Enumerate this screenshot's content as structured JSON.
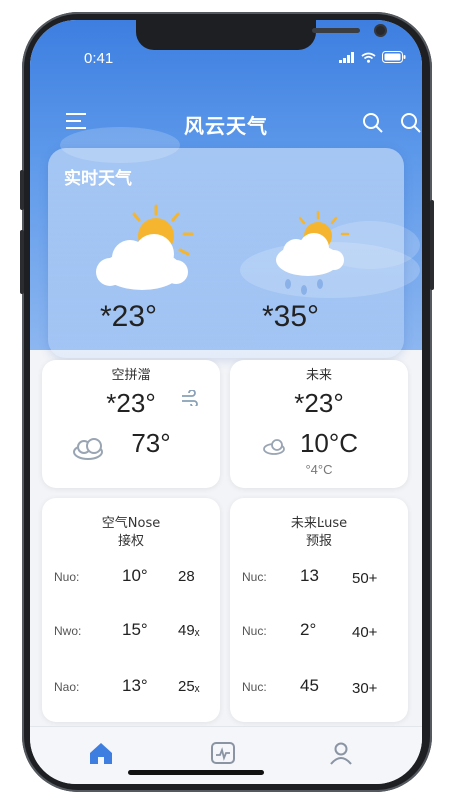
{
  "status": {
    "time": "0:41"
  },
  "header": {
    "title": "风云天气"
  },
  "hero": {
    "title": "实时天气",
    "temp_left": "*23°",
    "temp_right": "*35°"
  },
  "card_current": {
    "title": "空拼澢",
    "temp_main": "*23°",
    "temp_humid": "73°"
  },
  "card_future": {
    "title": "未来",
    "temp_main": "*23°",
    "temp_humid": "10°C",
    "temp_low": "°4°C"
  },
  "card_air": {
    "title_line1": "空气Nose",
    "title_line2": "接权",
    "rows": [
      {
        "label": "Nuo:",
        "value": "10°",
        "value2": "28"
      },
      {
        "label": "Nwo:",
        "value": "15°",
        "value2": "49ₓ"
      },
      {
        "label": "Nao:",
        "value": "13°",
        "value2": "25ₓ"
      }
    ]
  },
  "card_forecast": {
    "title_line1": "未来Ŀuse",
    "title_line2": "预报",
    "rows": [
      {
        "label": "Nuc:",
        "value": "13",
        "value2": "50+"
      },
      {
        "label": "Nuc:",
        "value": "2°",
        "value2": "40+"
      },
      {
        "label": "Nuc:",
        "value": "45",
        "value2": "30+"
      }
    ]
  },
  "tabs": [
    {
      "icon": "home-icon",
      "active": true
    },
    {
      "icon": "chart-icon",
      "active": false
    },
    {
      "icon": "user-icon",
      "active": false
    }
  ],
  "colors": {
    "accent": "#3d7ee0",
    "sun": "#f5b52e",
    "cloud": "#ffffff"
  }
}
